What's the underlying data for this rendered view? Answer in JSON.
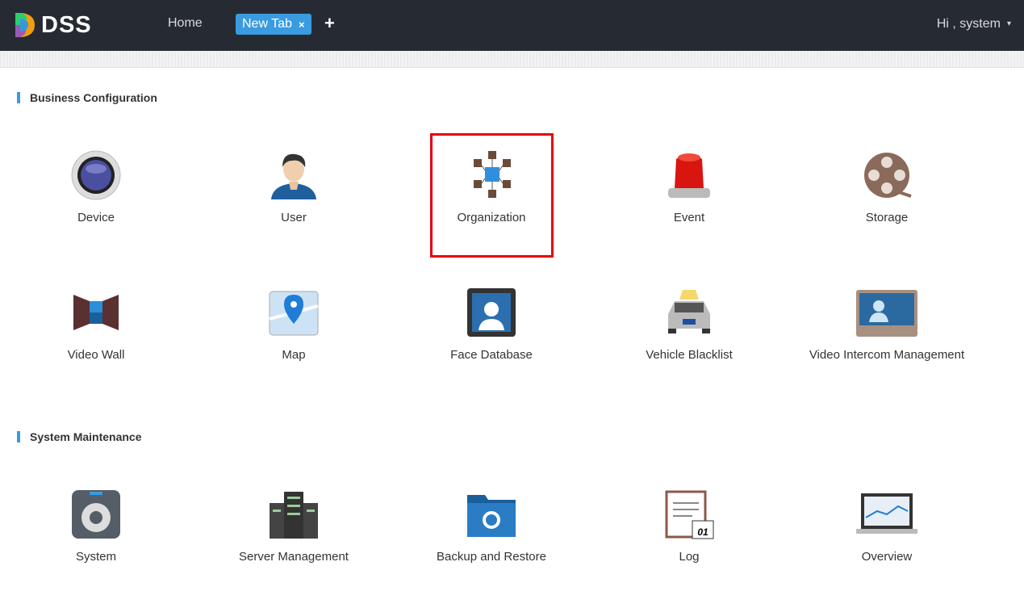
{
  "header": {
    "logo": "DSS",
    "home": "Home",
    "tabs": [
      {
        "label": "New Tab",
        "close": "×"
      }
    ],
    "add_tab": "+",
    "user": "Hi , system",
    "user_caret": "▾"
  },
  "colors": {
    "topbar": "#262b33",
    "accent": "#3a9be0",
    "highlight": "#e60012"
  },
  "sections": [
    {
      "title": "Business Configuration",
      "items": [
        {
          "label": "Device",
          "icon": "camera-dome-icon"
        },
        {
          "label": "User",
          "icon": "user-icon"
        },
        {
          "label": "Organization",
          "icon": "organization-cubes-icon",
          "highlighted": true
        },
        {
          "label": "Event",
          "icon": "alarm-light-icon"
        },
        {
          "label": "Storage",
          "icon": "film-reel-icon"
        },
        {
          "label": "Video Wall",
          "icon": "video-wall-icon"
        },
        {
          "label": "Map",
          "icon": "map-pin-icon"
        },
        {
          "label": "Face Database",
          "icon": "face-icon"
        },
        {
          "label": "Vehicle Blacklist",
          "icon": "car-icon"
        },
        {
          "label": "Video Intercom Management",
          "icon": "intercom-icon"
        }
      ]
    },
    {
      "title": "System Maintenance",
      "items": [
        {
          "label": "System",
          "icon": "system-gear-icon"
        },
        {
          "label": "Server Management",
          "icon": "server-icon"
        },
        {
          "label": "Backup and Restore",
          "icon": "backup-folder-icon"
        },
        {
          "label": "Log",
          "icon": "log-notepad-icon",
          "badge": "01"
        },
        {
          "label": "Overview",
          "icon": "laptop-chart-icon"
        }
      ]
    }
  ]
}
